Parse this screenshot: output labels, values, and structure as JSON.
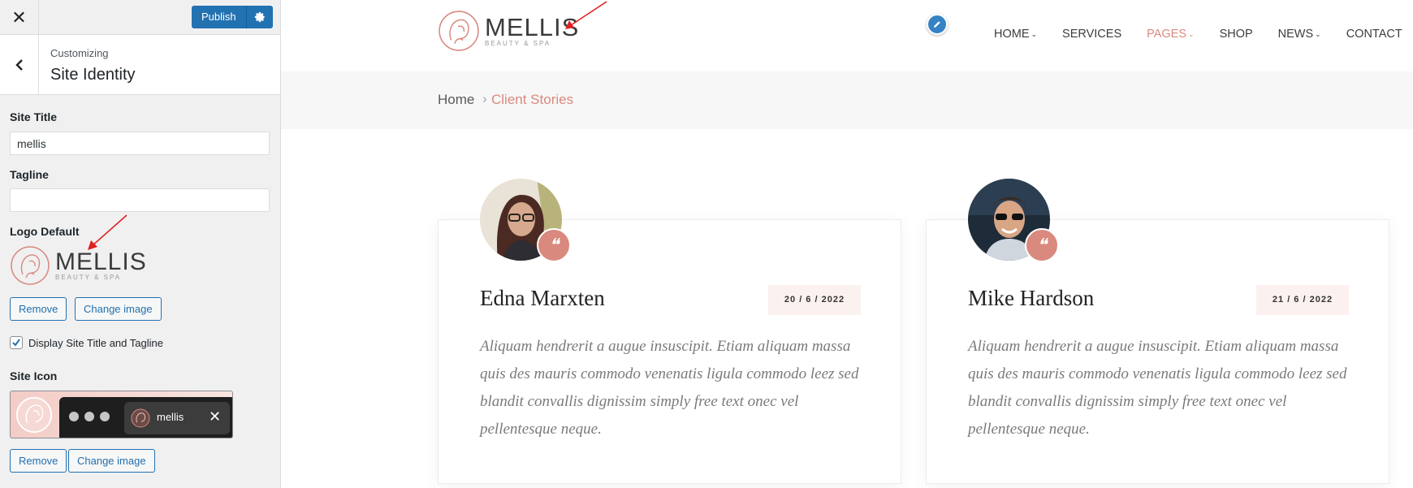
{
  "customizer": {
    "close_glyph": "✕",
    "publish_label": "Publish",
    "section_parent": "Customizing",
    "section_title": "Site Identity",
    "site_title_label": "Site Title",
    "site_title_value": "mellis",
    "tagline_label": "Tagline",
    "tagline_value": "",
    "logo_label": "Logo Default",
    "logo_text": "MELLIS",
    "logo_subtext": "BEAUTY & SPA",
    "remove_label": "Remove",
    "change_image_label": "Change image",
    "display_title_label": "Display Site Title and Tagline",
    "display_title_checked": true,
    "site_icon_label": "Site Icon",
    "browser_tab_title": "mellis",
    "browser_tab_close": "✕"
  },
  "site": {
    "logo_text": "MELLIS",
    "logo_subtext": "BEAUTY & SPA",
    "nav": [
      {
        "label": "HOME",
        "has_dropdown": true,
        "active": false
      },
      {
        "label": "SERVICES",
        "has_dropdown": false,
        "active": false
      },
      {
        "label": "PAGES",
        "has_dropdown": true,
        "active": true
      },
      {
        "label": "SHOP",
        "has_dropdown": false,
        "active": false
      },
      {
        "label": "NEWS",
        "has_dropdown": true,
        "active": false
      },
      {
        "label": "CONTACT",
        "has_dropdown": false,
        "active": false
      }
    ],
    "breadcrumb": {
      "home": "Home",
      "separator": "›",
      "current": "Client Stories"
    },
    "testimonials": [
      {
        "name": "Edna Marxten",
        "date": "20 / 6 / 2022",
        "quote": "Aliquam hendrerit a augue insuscipit. Etiam aliquam massa quis des mauris commodo venenatis ligula commodo leez sed blandit convallis dignissim simply free text onec vel pellentesque neque."
      },
      {
        "name": "Mike Hardson",
        "date": "21 / 6 / 2022",
        "quote": "Aliquam hendrerit a augue insuscipit. Etiam aliquam massa quis des mauris commodo venenatis ligula commodo leez sed blandit convallis dignissim simply free text onec vel pellentesque neque."
      }
    ]
  },
  "colors": {
    "wp_blue": "#2271b1",
    "accent": "#d9897e",
    "annotation_arrow": "#e02020"
  }
}
